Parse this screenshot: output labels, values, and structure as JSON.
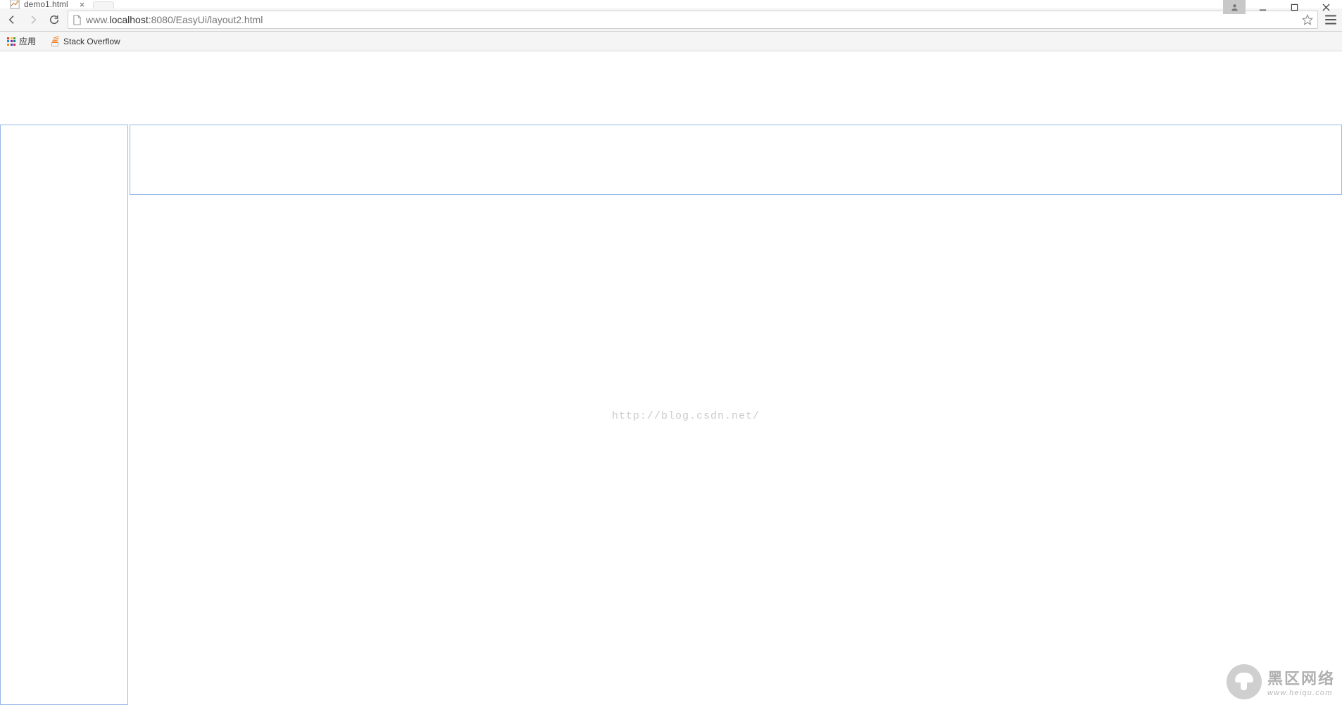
{
  "tab": {
    "title": "demo1.html",
    "close_glyph": "×"
  },
  "address": {
    "url_display_prefix": "www.",
    "url_display_host": "localhost",
    "url_display_rest": ":8080/EasyUi/layout2.html",
    "full_url": "www.localhost:8080/EasyUi/layout2.html"
  },
  "bookmarks": {
    "apps_label": "应用",
    "items": [
      {
        "label": "Stack Overflow"
      }
    ]
  },
  "watermarks": {
    "center_text": "http://blog.csdn.net/",
    "logo_main": "黑区网络",
    "logo_sub": "www.heiqu.com"
  }
}
